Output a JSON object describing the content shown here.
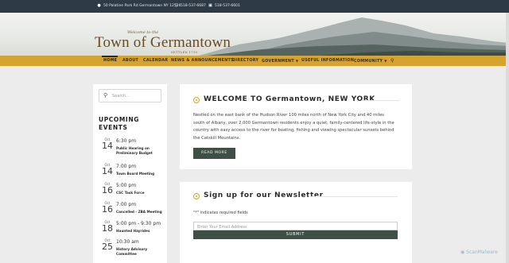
{
  "topbar": {
    "address": "50 Palatine Park Rd Germantown NY 12526",
    "phone": "518-537-6687",
    "fax": "518-537-6601",
    "address_icon": "map-marker-icon",
    "phone_icon": "mobile-phone-icon",
    "fax_icon": "fax-icon"
  },
  "logo": {
    "welcome": "Welcome to the",
    "name": "Town of Germantown",
    "settled": "SETTLED 1710"
  },
  "nav": {
    "items": [
      "HOME",
      "ABOUT",
      "CALENDAR",
      "NEWS & ANNOUNCEMENTS",
      "DIRECTORY",
      "GOVERNMENT",
      "USEFUL INFORMATION",
      "COMMUNITY"
    ],
    "active": "HOME",
    "search_icon": "search-icon"
  },
  "sidebar": {
    "search_placeholder": "Search...",
    "upcoming_title": "UPCOMING EVENTS",
    "events": [
      {
        "month": "Oct",
        "day": "14",
        "time": "6:30 pm",
        "title": "Public Hearing on Preliminary Budget"
      },
      {
        "month": "Oct",
        "day": "14",
        "time": "7:00 pm",
        "title": "Town Board Meeting"
      },
      {
        "month": "Oct",
        "day": "16",
        "time": "5:00 pm",
        "title": "CSC Task Force"
      },
      {
        "month": "Oct",
        "day": "16",
        "time": "7:00 pm",
        "title": "Cancelled - ZBA Meeting"
      },
      {
        "month": "Oct",
        "day": "18",
        "time": "5:00 pm - 9:30 pm",
        "title": "Haunted Hayrides"
      },
      {
        "month": "Oct",
        "day": "25",
        "time": "10:30 am",
        "title": "History Advisory Committee"
      }
    ]
  },
  "welcome": {
    "heading": "WELCOME TO Germantown, NEW YORK",
    "body": "Nestled on the east bank of the Hudson River 100 miles north of New York City and 40 miles south of Albany, over 2,000 Germantown residents enjoy a quiet, family-centered life-style in the country with easy access to the river for boating, fishing and viewing spectacular sunsets behind the Catskill Mountains.",
    "button": "READ MORE"
  },
  "newsletter": {
    "heading": "Sign up for our Newsletter",
    "required_note": "\"*\" indicates required fields",
    "email_placeholder": "Enter Your Email Address",
    "submit": "SUBMIT"
  },
  "watermark": "ScanMalware",
  "colors": {
    "nav_gold": "#d6a32f",
    "topbar": "#2e3a46",
    "button_green": "#3e4f46",
    "logo_brown": "#6a4a22"
  }
}
